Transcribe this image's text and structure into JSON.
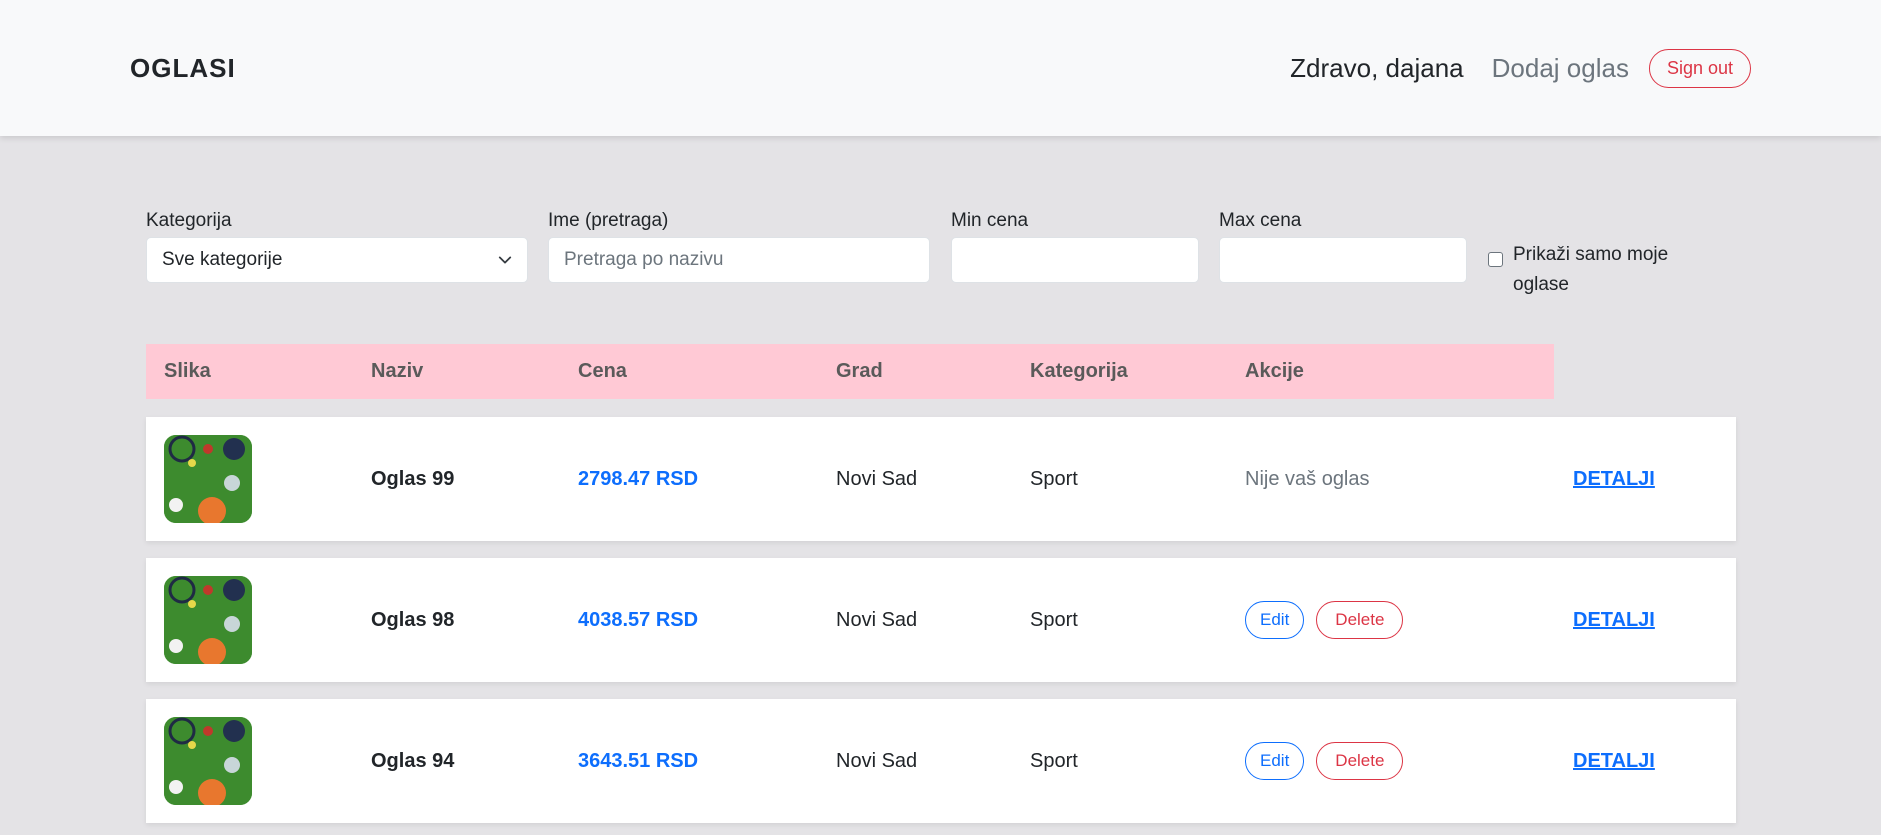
{
  "navbar": {
    "brand": "OGLASI",
    "greeting": "Zdravo, dajana",
    "add_ad": "Dodaj oglas",
    "sign_out": "Sign out"
  },
  "filters": {
    "category": {
      "label": "Kategorija",
      "value": "Sve kategorije"
    },
    "name": {
      "label": "Ime (pretraga)",
      "placeholder": "Pretraga po nazivu",
      "value": ""
    },
    "min_price": {
      "label": "Min cena",
      "value": ""
    },
    "max_price": {
      "label": "Max cena",
      "value": ""
    },
    "only_mine": {
      "label": "Prikaži samo moje oglase",
      "checked": false
    }
  },
  "table": {
    "headers": [
      "Slika",
      "Naziv",
      "Cena",
      "Grad",
      "Kategorija",
      "Akcije"
    ],
    "rows": [
      {
        "name": "Oglas 99",
        "price": "2798.47 RSD",
        "city": "Novi Sad",
        "category": "Sport",
        "actions": "Nije vaš oglas",
        "details": "DETALJI"
      },
      {
        "name": "Oglas 98",
        "price": "4038.57 RSD",
        "city": "Novi Sad",
        "category": "Sport",
        "edit": "Edit",
        "delete": "Delete",
        "details": "DETALJI"
      },
      {
        "name": "Oglas 94",
        "price": "3643.51 RSD",
        "city": "Novi Sad",
        "category": "Sport",
        "edit": "Edit",
        "delete": "Delete",
        "details": "DETALJI"
      }
    ]
  },
  "colors": {
    "header_bg": "#ffc9d5",
    "price": "#0d6efd",
    "danger": "#dc3545"
  }
}
